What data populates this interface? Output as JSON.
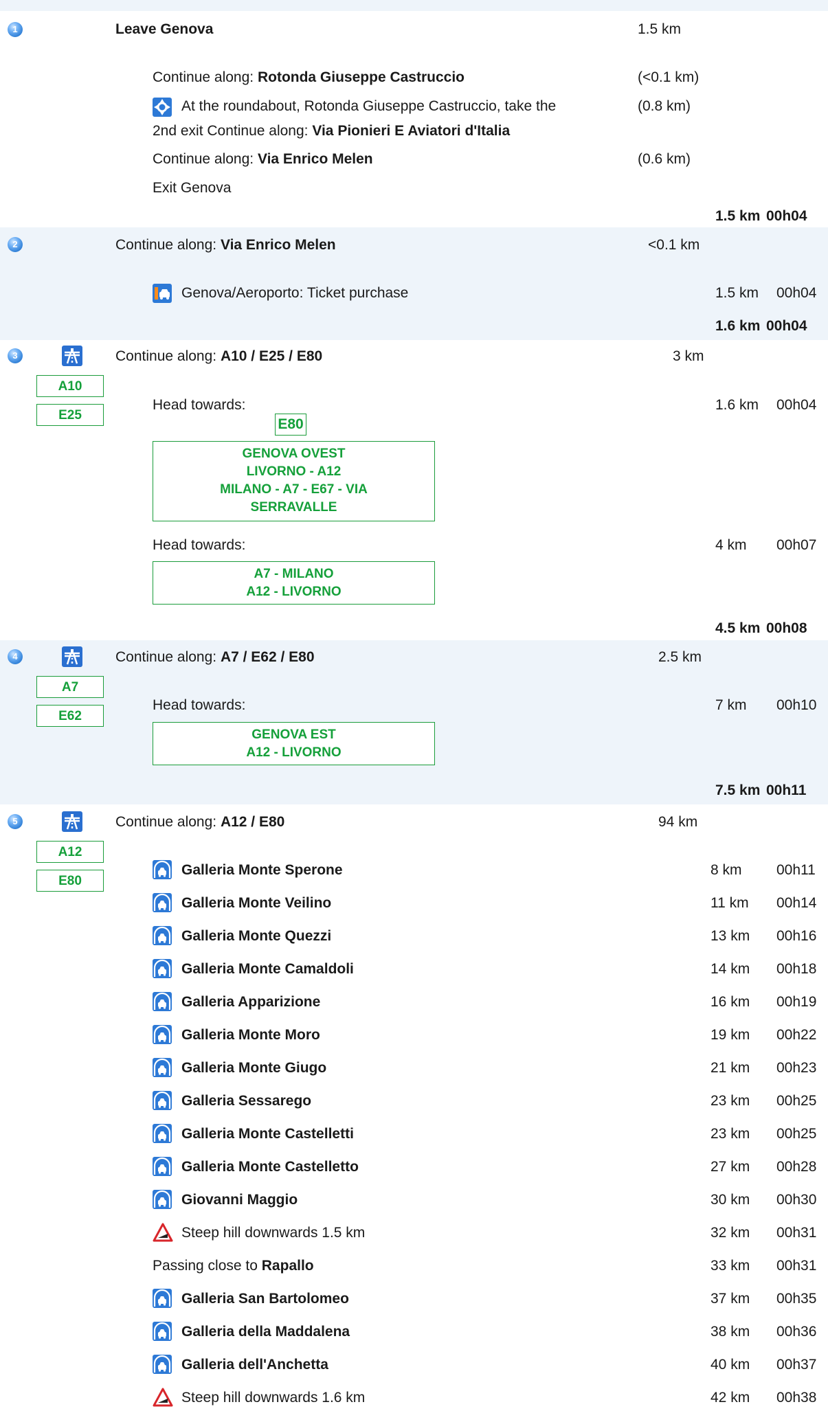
{
  "steps": [
    {
      "num": "1",
      "title": "Leave Genova",
      "dist": "1.5 km",
      "sub": [
        {
          "prefix": "Continue along: ",
          "road": "Rotonda Giuseppe Castruccio",
          "dist": "(<0.1 km)"
        },
        {
          "line1": "At the roundabout, Rotonda Giuseppe Castruccio, take the",
          "line2_prefix": "2nd exit Continue along: ",
          "road": "Via Pionieri E Aviatori d'Italia",
          "dist": "(0.8 km)"
        },
        {
          "prefix": "Continue along: ",
          "road": "Via Enrico Melen",
          "dist": "(0.6 km)"
        },
        {
          "text": "Exit Genova"
        }
      ],
      "total_dist": "1.5 km",
      "total_time": "00h04"
    },
    {
      "num": "2",
      "title_prefix": "Continue along: ",
      "road": "Via Enrico Melen",
      "dist": "<0.1 km",
      "sub": [
        {
          "text": "Genova/Aeroporto: Ticket purchase",
          "dist": "1.5 km",
          "time": "00h04"
        }
      ],
      "total_dist": "1.6 km",
      "total_time": "00h04"
    },
    {
      "num": "3",
      "title_prefix": "Continue along: ",
      "road": "A10 / E25 / E80",
      "dist": "3 km",
      "badges": [
        "A10",
        "E25"
      ],
      "sub": [
        {
          "text": "Head towards:",
          "dist": "1.6 km",
          "time": "00h04",
          "shield": "E80",
          "sign": [
            "GENOVA OVEST",
            "LIVORNO - A12",
            "MILANO - A7 - E67 - VIA",
            "SERRAVALLE"
          ]
        },
        {
          "text": "Head towards:",
          "dist": "4 km",
          "time": "00h07",
          "sign": [
            "A7 - MILANO",
            "A12 - LIVORNO"
          ]
        }
      ],
      "total_dist": "4.5 km",
      "total_time": "00h08"
    },
    {
      "num": "4",
      "title_prefix": "Continue along: ",
      "road": "A7 / E62 / E80",
      "dist": "2.5 km",
      "badges": [
        "A7",
        "E62"
      ],
      "sub": [
        {
          "text": "Head towards:",
          "dist": "7 km",
          "time": "00h10",
          "sign": [
            "GENOVA EST",
            "A12 - LIVORNO"
          ]
        }
      ],
      "total_dist": "7.5 km",
      "total_time": "00h11"
    },
    {
      "num": "5",
      "title_prefix": "Continue along: ",
      "road": "A12 / E80",
      "dist": "94 km",
      "badges": [
        "A12",
        "E80"
      ],
      "items": [
        {
          "icon": "tunnel-icon",
          "name": "Galleria Monte Sperone",
          "dist": "8 km",
          "time": "00h11"
        },
        {
          "icon": "tunnel-icon",
          "name": "Galleria Monte Veilino",
          "dist": "11 km",
          "time": "00h14"
        },
        {
          "icon": "tunnel-icon",
          "name": "Galleria Monte Quezzi",
          "dist": "13 km",
          "time": "00h16"
        },
        {
          "icon": "tunnel-icon",
          "name": "Galleria Monte Camaldoli",
          "dist": "14 km",
          "time": "00h18"
        },
        {
          "icon": "tunnel-icon",
          "name": "Galleria Apparizione",
          "dist": "16 km",
          "time": "00h19"
        },
        {
          "icon": "tunnel-icon",
          "name": "Galleria Monte Moro",
          "dist": "19 km",
          "time": "00h22"
        },
        {
          "icon": "tunnel-icon",
          "name": "Galleria Monte Giugo",
          "dist": "21 km",
          "time": "00h23"
        },
        {
          "icon": "tunnel-icon",
          "name": "Galleria Sessarego",
          "dist": "23 km",
          "time": "00h25"
        },
        {
          "icon": "tunnel-icon",
          "name": "Galleria Monte Castelletti",
          "dist": "23 km",
          "time": "00h25"
        },
        {
          "icon": "tunnel-icon",
          "name": "Galleria Monte Castelletto",
          "dist": "27 km",
          "time": "00h28"
        },
        {
          "icon": "tunnel-icon",
          "name": "Giovanni Maggio",
          "dist": "30 km",
          "time": "00h30"
        },
        {
          "icon": "steep-hill-icon",
          "text": "Steep hill downwards 1.5 km",
          "dist": "32 km",
          "time": "00h31"
        },
        {
          "icon": "",
          "prefix": "Passing close to ",
          "name": "Rapallo",
          "dist": "33 km",
          "time": "00h31"
        },
        {
          "icon": "tunnel-icon",
          "name": "Galleria San Bartolomeo",
          "dist": "37 km",
          "time": "00h35"
        },
        {
          "icon": "tunnel-icon",
          "name": "Galleria della Maddalena",
          "dist": "38 km",
          "time": "00h36"
        },
        {
          "icon": "tunnel-icon",
          "name": "Galleria dell'Anchetta",
          "dist": "40 km",
          "time": "00h37"
        },
        {
          "icon": "steep-hill-icon",
          "text": "Steep hill downwards 1.6 km",
          "dist": "42 km",
          "time": "00h38"
        }
      ]
    }
  ]
}
